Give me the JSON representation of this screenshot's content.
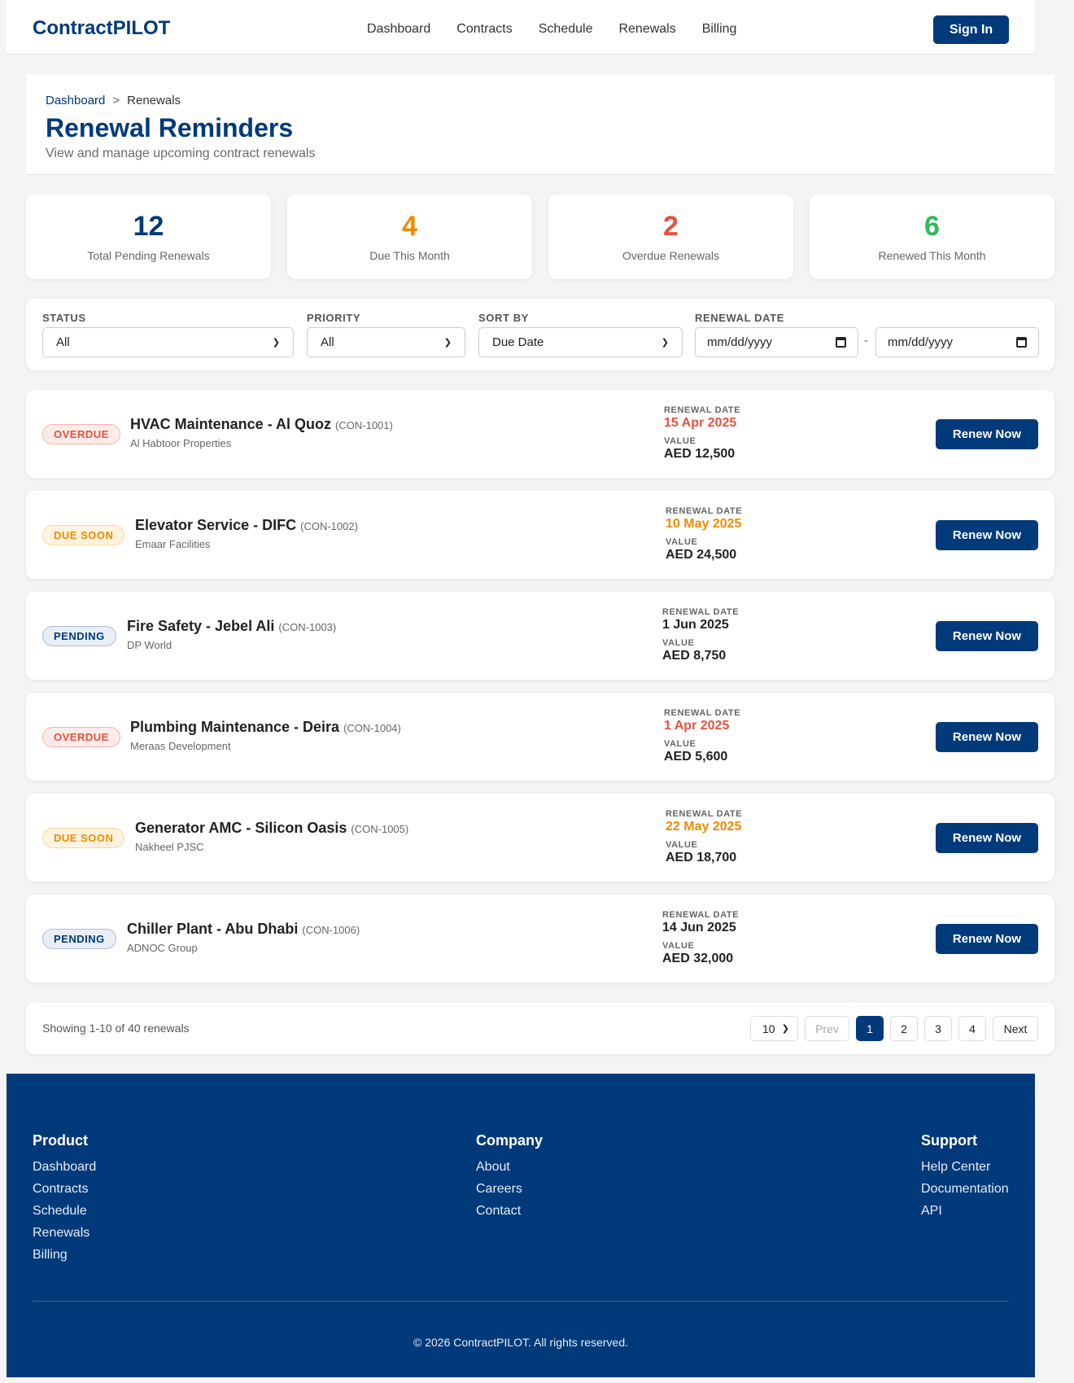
{
  "nav": {
    "brand": "ContractPILOT",
    "links": [
      "Dashboard",
      "Contracts",
      "Schedule",
      "Renewals",
      "Billing"
    ],
    "signin": "Sign In"
  },
  "header": {
    "breadcrumb": {
      "home": "Dashboard",
      "separator": ">",
      "current": "Renewals"
    },
    "title": "Renewal Reminders",
    "subtitle": "View and manage upcoming contract renewals"
  },
  "stats": [
    {
      "value": "12",
      "label": "Total Pending Renewals",
      "color": "#003a7a"
    },
    {
      "value": "4",
      "label": "Due This Month",
      "color": "#f28b00"
    },
    {
      "value": "2",
      "label": "Overdue Renewals",
      "color": "#e5533c"
    },
    {
      "value": "6",
      "label": "Renewed This Month",
      "color": "#2dbb5b"
    }
  ],
  "filters": {
    "status": {
      "label": "STATUS",
      "value": "All"
    },
    "priority": {
      "label": "PRIORITY",
      "value": "All"
    },
    "sort": {
      "label": "SORT BY",
      "value": "Due Date"
    },
    "date": {
      "label": "RENEWAL DATE",
      "from": "mm/dd/yyyy",
      "to": "mm/dd/yyyy",
      "separator": "-"
    }
  },
  "renewals": [
    {
      "status": "OVERDUE",
      "title": "HVAC Maintenance - Al Quoz",
      "id": "(CON-1001)",
      "client": "Al Habtoor Properties",
      "date_label": "RENEWAL DATE",
      "date": "15 Apr 2025",
      "value_label": "VALUE",
      "value": "AED 12,500",
      "action": "Renew Now"
    },
    {
      "status": "DUE SOON",
      "title": "Elevator Service - DIFC",
      "id": "(CON-1002)",
      "client": "Emaar Facilities",
      "date_label": "RENEWAL DATE",
      "date": "10 May 2025",
      "value_label": "VALUE",
      "value": "AED 24,500",
      "action": "Renew Now"
    },
    {
      "status": "PENDING",
      "title": "Fire Safety - Jebel Ali",
      "id": "(CON-1003)",
      "client": "DP World",
      "date_label": "RENEWAL DATE",
      "date": "1 Jun 2025",
      "value_label": "VALUE",
      "value": "AED 8,750",
      "action": "Renew Now"
    },
    {
      "status": "OVERDUE",
      "title": "Plumbing Maintenance - Deira",
      "id": "(CON-1004)",
      "client": "Meraas Development",
      "date_label": "RENEWAL DATE",
      "date": "1 Apr 2025",
      "value_label": "VALUE",
      "value": "AED 5,600",
      "action": "Renew Now"
    },
    {
      "status": "DUE SOON",
      "title": "Generator AMC - Silicon Oasis",
      "id": "(CON-1005)",
      "client": "Nakheel PJSC",
      "date_label": "RENEWAL DATE",
      "date": "22 May 2025",
      "value_label": "VALUE",
      "value": "AED 18,700",
      "action": "Renew Now"
    },
    {
      "status": "PENDING",
      "title": "Chiller Plant - Abu Dhabi",
      "id": "(CON-1006)",
      "client": "ADNOC Group",
      "date_label": "RENEWAL DATE",
      "date": "14 Jun 2025",
      "value_label": "VALUE",
      "value": "AED 32,000",
      "action": "Renew Now"
    }
  ],
  "status_colors": {
    "overdue": "#e5533c",
    "due_soon": "#f28b00",
    "pending": "#222222"
  },
  "pagination": {
    "showing": "Showing 1-10 of 40 renewals",
    "per_page": "10",
    "prev": "Prev",
    "pages": [
      "1",
      "2",
      "3",
      "4"
    ],
    "active_page": "1",
    "next": "Next"
  },
  "footer": {
    "product": {
      "heading": "Product",
      "links": [
        "Dashboard",
        "Contracts",
        "Schedule",
        "Renewals",
        "Billing"
      ]
    },
    "company": {
      "heading": "Company",
      "links": [
        "About",
        "Careers",
        "Contact"
      ]
    },
    "support": {
      "heading": "Support",
      "links": [
        "Help Center",
        "Documentation",
        "API"
      ]
    },
    "copyright": "© 2026 ContractPILOT. All rights reserved."
  }
}
